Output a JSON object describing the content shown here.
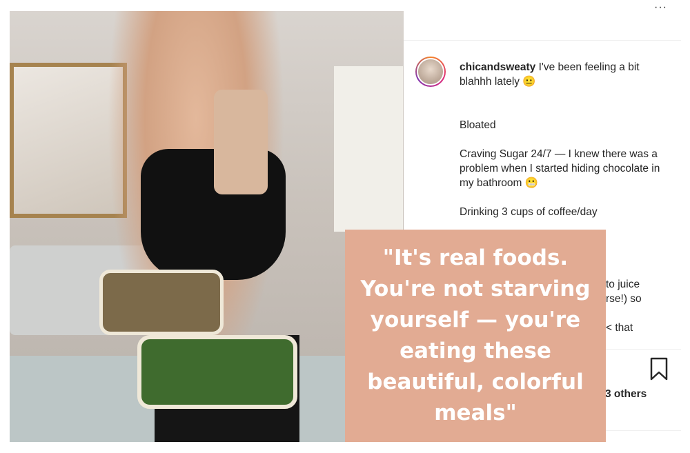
{
  "post": {
    "username": "chicandsweaty",
    "caption_first": "I've been feeling a bit blahhh lately 😐",
    "caption_lines": [
      "Bloated",
      "Craving Sugar 24/7 — I knew there was a problem when I started hiding chocolate in my bathroom 😬",
      "Drinking 3 cups of coffee/day"
    ],
    "partial_lines": [
      "to juice",
      "rse!) so",
      "< that"
    ],
    "likes_text": "3 others",
    "more_icon": "more-options-icon",
    "bookmark_icon": "bookmark-icon"
  },
  "quote": {
    "text": "\"It's real foods. You're not starving yourself —  you're eating these beautiful, colorful meals\""
  },
  "colors": {
    "quote_background": "#e2ab93",
    "quote_text": "#ffffff",
    "username_text": "#262626"
  }
}
